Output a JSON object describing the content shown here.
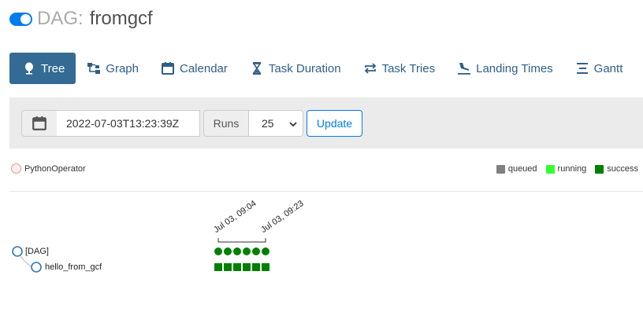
{
  "header": {
    "prefix": "DAG:",
    "dag_id": "fromgcf",
    "toggle_on": true,
    "accent": "#017cee"
  },
  "nav": {
    "tabs": [
      {
        "label": "Tree",
        "icon": "tree-icon",
        "active": true
      },
      {
        "label": "Graph",
        "icon": "graph-icon",
        "active": false
      },
      {
        "label": "Calendar",
        "icon": "calendar-icon",
        "active": false
      },
      {
        "label": "Task Duration",
        "icon": "hourglass-icon",
        "active": false
      },
      {
        "label": "Task Tries",
        "icon": "repeat-icon",
        "active": false
      },
      {
        "label": "Landing Times",
        "icon": "landing-icon",
        "active": false
      },
      {
        "label": "Gantt",
        "icon": "gantt-icon",
        "active": false
      }
    ]
  },
  "form": {
    "base_date": "2022-07-03T13:23:39Z",
    "runs_label": "Runs",
    "runs_value": "25",
    "update_label": "Update"
  },
  "legend": {
    "operator": "PythonOperator",
    "states": [
      {
        "label": "queued",
        "color": "#808080"
      },
      {
        "label": "running",
        "color": "#32ff32"
      },
      {
        "label": "success",
        "color": "#008000"
      }
    ]
  },
  "tree": {
    "root": "[DAG]",
    "tasks": [
      "hello_from_gcf"
    ],
    "first_run_label": "Jul 03, 09:04",
    "last_run_label": "Jul 03, 09:23",
    "run_count": 6,
    "run_state_color": "#008000"
  }
}
